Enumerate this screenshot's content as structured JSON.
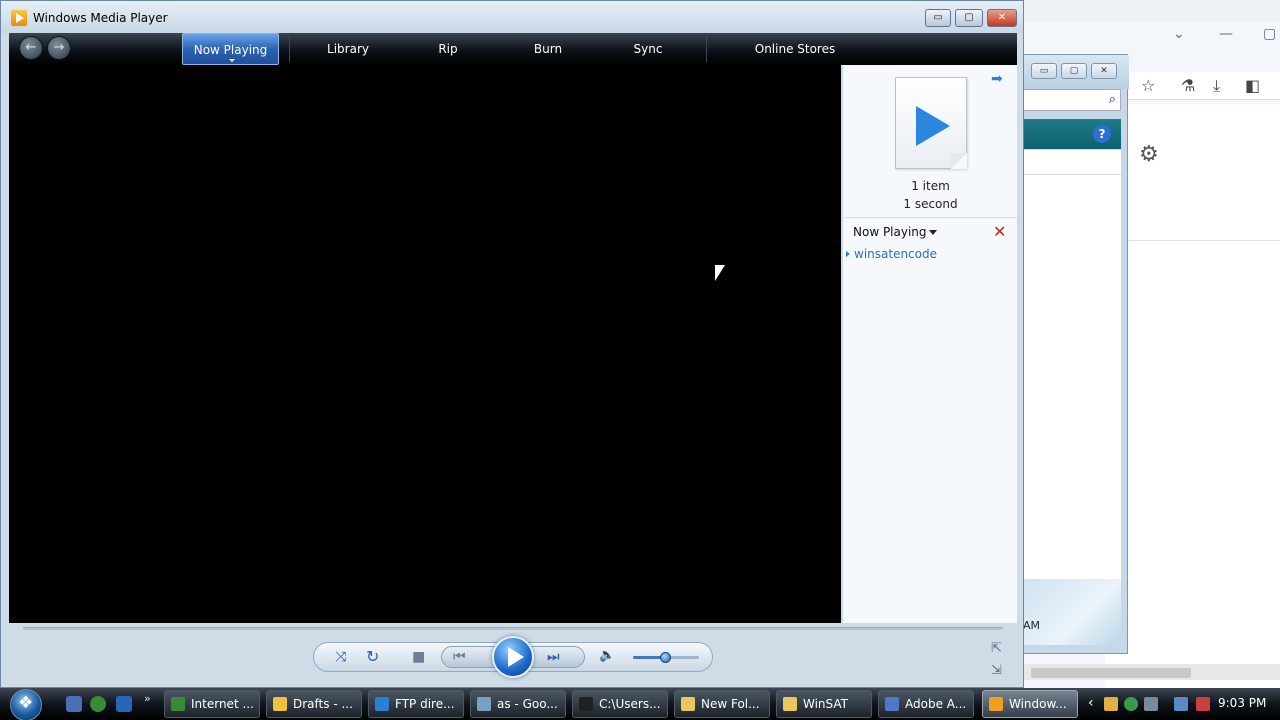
{
  "window": {
    "title": "Windows Media Player",
    "buttons": {
      "minimize": "▭",
      "maximize": "▢",
      "close": "✕"
    }
  },
  "nav": {
    "back_icon": "←",
    "forward_icon": "→",
    "tabs": [
      "Now Playing",
      "Library",
      "Rip",
      "Burn",
      "Sync",
      "Online Stores"
    ],
    "active_tab": "Now Playing"
  },
  "list_pane": {
    "item_count": "1 item",
    "duration": "1 second",
    "now_playing_label": "Now Playing",
    "clear_icon": "✕",
    "forward_arrow": "➡",
    "items": [
      "winsatencode"
    ]
  },
  "controls": {
    "shuffle": "⤨",
    "repeat": "↻",
    "stop": "■",
    "previous": "⏮",
    "next": "⏭",
    "mute": "🔈",
    "volume_level": 0.5
  },
  "background_window": {
    "fragment_text": "AM",
    "icons": [
      "star-icon",
      "flask-icon",
      "download-icon",
      "sidebar-icon",
      "gear-icon",
      "search-icon",
      "help-icon"
    ]
  },
  "taskbar": {
    "tasks": [
      {
        "label": "Internet ...",
        "color": "#3a8a3a"
      },
      {
        "label": "Drafts - ...",
        "color": "#f0c040"
      },
      {
        "label": "FTP dire...",
        "color": "#2a7fd4"
      },
      {
        "label": "as - Goo...",
        "color": "#7aa0c0"
      },
      {
        "label": "C:\\Users...",
        "color": "#202020"
      },
      {
        "label": "New Fol...",
        "color": "#e8c85a"
      },
      {
        "label": "WinSAT",
        "color": "#e8c85a"
      },
      {
        "label": "Adobe A...",
        "color": "#5078c8"
      },
      {
        "label": "Window...",
        "color": "#f0a020"
      }
    ],
    "active_task_index": 8,
    "clock": "9:03 PM"
  }
}
